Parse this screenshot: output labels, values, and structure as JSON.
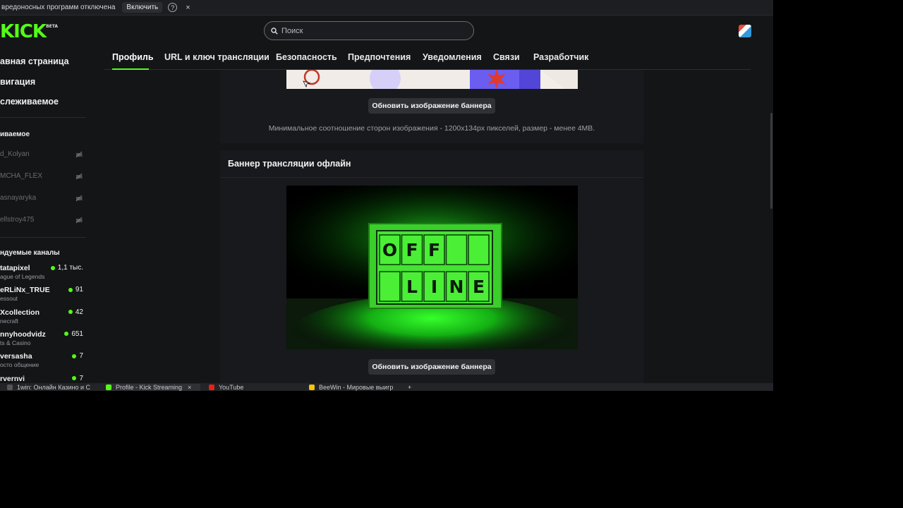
{
  "notice": {
    "text": "вредоносных программ отключена",
    "enable_label": "Включить",
    "help_glyph": "?",
    "close_glyph": "×"
  },
  "header": {
    "logo": "KICK",
    "logo_badge": "BETA",
    "search_placeholder": "Поиск"
  },
  "sidebar": {
    "nav": [
      "авная страница",
      "вигация",
      "слеживаемое"
    ],
    "following_title": "иваемое",
    "following": [
      "d_Kolyan",
      "MCHA_FLEX",
      "asnayaryka",
      "ellstroy475"
    ],
    "recommended_title": "ндуемые каналы",
    "recommended": [
      {
        "name": "tatapixel",
        "category": "ague of Legends",
        "viewers": "1,1 тыс."
      },
      {
        "name": "eRLiNx_TRUE",
        "category": "essout",
        "viewers": "91"
      },
      {
        "name": "Xcollection",
        "category": "necraft",
        "viewers": "42"
      },
      {
        "name": "nnyhoodvidz",
        "category": "ts & Casino",
        "viewers": "651"
      },
      {
        "name": "versasha",
        "category": "осто общение",
        "viewers": "7"
      },
      {
        "name": "rvernvi",
        "category": "",
        "viewers": "7"
      }
    ]
  },
  "tabs": [
    "Профиль",
    "URL и ключ трансляции",
    "Безопасность",
    "Предпочтения",
    "Уведомления",
    "Связи",
    "Разработчик"
  ],
  "active_tab": "Профиль",
  "profile_banner": {
    "update_button": "Обновить изображение баннера",
    "hint": "Минимальное соотношение сторон изображения - 1200x134px пикселей, размер - менее 4MB."
  },
  "offline_banner": {
    "title": "Баннер трансляции офлайн",
    "sign_row1": [
      "O",
      "F",
      "F",
      "",
      ""
    ],
    "sign_row2": [
      "",
      "L",
      "I",
      "N",
      "E"
    ],
    "update_button": "Обновить изображение баннера"
  },
  "browser_tabs": [
    {
      "title": "1win: Онлайн Казино и С"
    },
    {
      "title": "Profile - Kick Streaming",
      "close_glyph": "×"
    },
    {
      "title": "YouTube"
    },
    {
      "title": "BeeWin - Мировые выигр"
    },
    {
      "title": "+"
    }
  ],
  "colors": {
    "accent": "#53fc18",
    "background": "#141517",
    "panel": "#18191c",
    "button": "#303135"
  }
}
